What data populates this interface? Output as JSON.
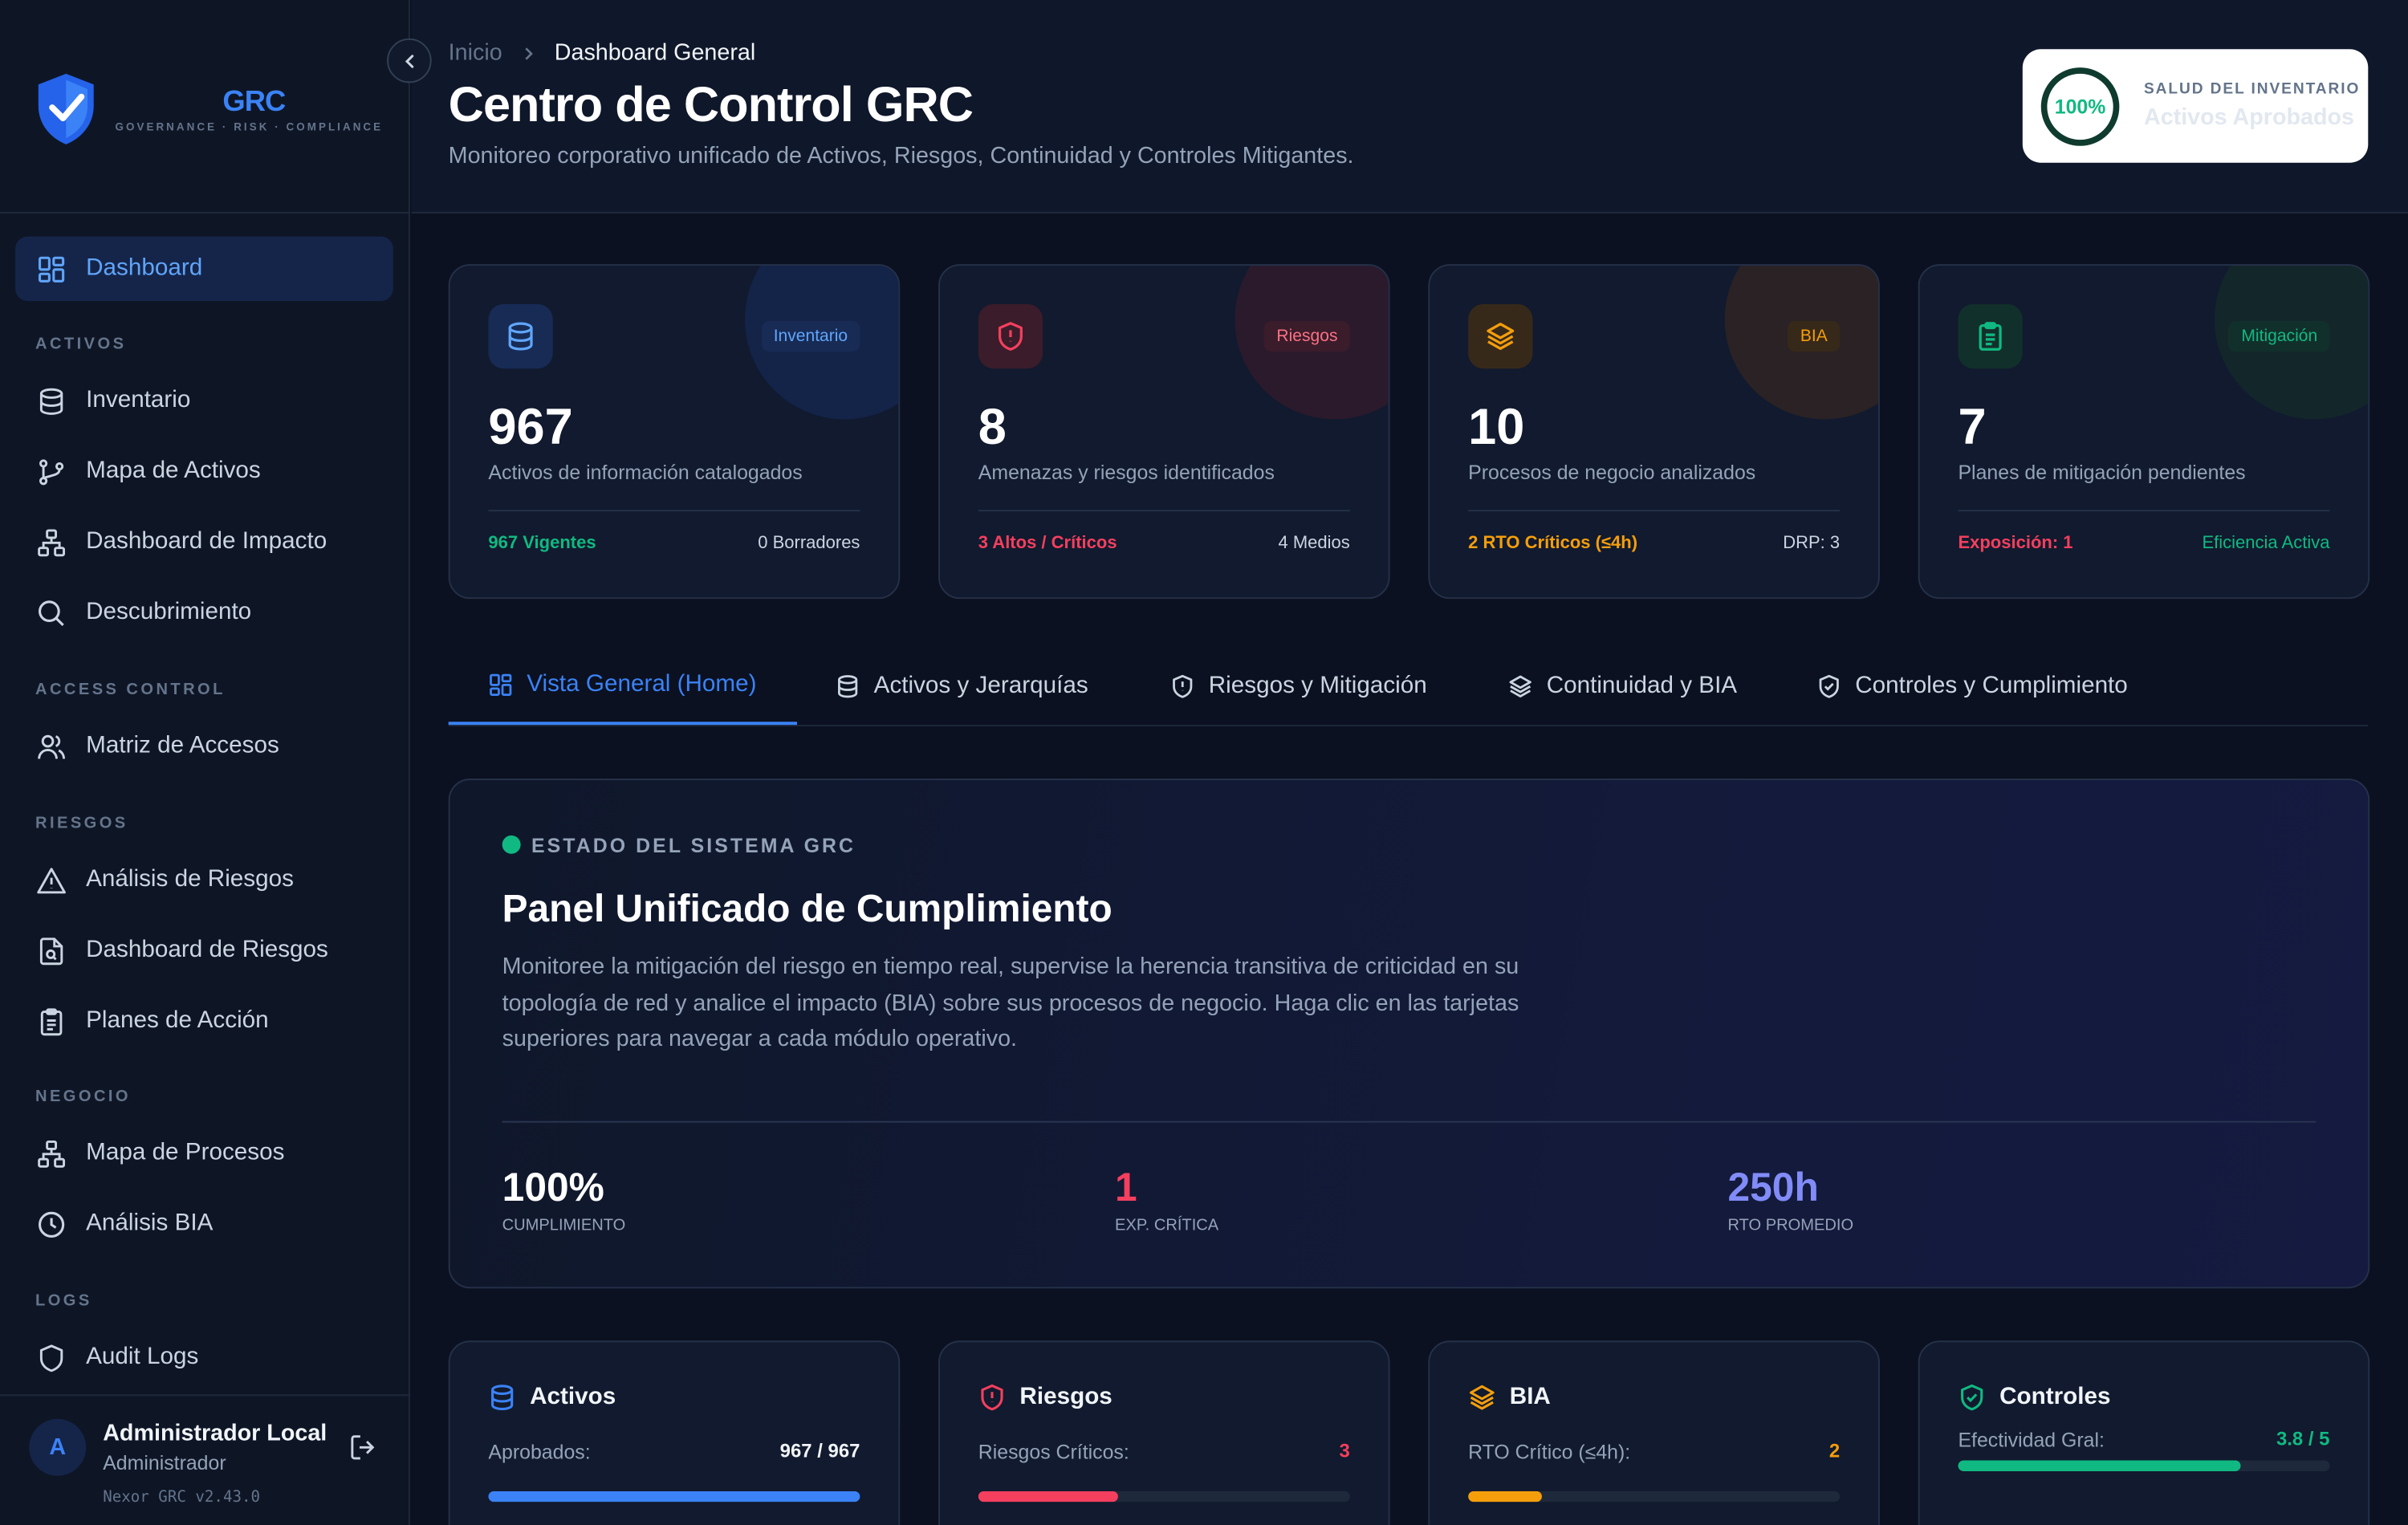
{
  "brand": {
    "logo_text": "GRC",
    "tagline": "GOVERNANCE · RISK · COMPLIANCE"
  },
  "sidebar": {
    "sections": {
      "activos": "ACTIVOS",
      "access": "ACCESS CONTROL",
      "riesgos": "RIESGOS",
      "negocio": "NEGOCIO",
      "logs": "LOGS"
    },
    "items": [
      {
        "label": "Dashboard",
        "icon": "grid-icon",
        "active": true
      },
      {
        "label": "Inventario",
        "icon": "database-icon"
      },
      {
        "label": "Mapa de Activos",
        "icon": "branch-icon"
      },
      {
        "label": "Dashboard de Impacto",
        "icon": "network-icon"
      },
      {
        "label": "Descubrimiento",
        "icon": "search-icon"
      },
      {
        "label": "Matriz de Accesos",
        "icon": "users-icon"
      },
      {
        "label": "Análisis de Riesgos",
        "icon": "warning-icon"
      },
      {
        "label": "Dashboard de Riesgos",
        "icon": "file-search-icon"
      },
      {
        "label": "Planes de Acción",
        "icon": "clipboard-icon"
      },
      {
        "label": "Mapa de Procesos",
        "icon": "network-icon"
      },
      {
        "label": "Análisis BIA",
        "icon": "clock-icon"
      },
      {
        "label": "Audit Logs",
        "icon": "shield-icon"
      }
    ],
    "user": {
      "initial": "A",
      "name": "Administrador Local",
      "role": "Administrador",
      "version": "Nexor GRC v2.43.0"
    }
  },
  "header": {
    "breadcrumb": {
      "root": "Inicio",
      "current": "Dashboard General"
    },
    "title": "Centro de Control GRC",
    "subtitle": "Monitoreo corporativo unificado de Activos, Riesgos, Continuidad y Controles Mitigantes.",
    "health": {
      "value": "100%",
      "label": "SALUD DEL INVENTARIO",
      "status": "Activos Aprobados"
    }
  },
  "kpis": [
    {
      "badge": "Inventario",
      "value": "967",
      "desc": "Activos de información catalogados",
      "left": "967 Vigentes",
      "right": "0 Borradores",
      "color": "#3b82f6",
      "icon": "database-icon"
    },
    {
      "badge": "Riesgos",
      "value": "8",
      "desc": "Amenazas y riesgos identificados",
      "left": "3 Altos / Críticos",
      "right": "4 Medios",
      "color": "#f43f5e",
      "icon": "shield-alert-icon"
    },
    {
      "badge": "BIA",
      "value": "10",
      "desc": "Procesos de negocio analizados",
      "left": "2 RTO Críticos (≤4h)",
      "right": "DRP: 3",
      "color": "#f59e0b",
      "icon": "layers-icon"
    },
    {
      "badge": "Mitigación",
      "value": "7",
      "desc": "Planes de mitigación pendientes",
      "left": "Exposición: 1",
      "right": "Eficiencia Activa",
      "color": "#10b981",
      "icon": "clipboard-icon"
    }
  ],
  "tabs": [
    {
      "label": "Vista General (Home)",
      "icon": "grid-icon",
      "active": true
    },
    {
      "label": "Activos y Jerarquías",
      "icon": "database-icon"
    },
    {
      "label": "Riesgos y Mitigación",
      "icon": "shield-alert-icon"
    },
    {
      "label": "Continuidad y BIA",
      "icon": "layers-icon"
    },
    {
      "label": "Controles y Cumplimiento",
      "icon": "shield-check-icon"
    }
  ],
  "hero": {
    "eyebrow": "ESTADO DEL SISTEMA GRC",
    "title": "Panel Unificado de Cumplimiento",
    "description": "Monitoree la mitigación del riesgo en tiempo real, supervise la herencia transitiva de criticidad en su topología de red y analice el impacto (BIA) sobre sus procesos de negocio. Haga clic en las tarjetas superiores para navegar a cada módulo operativo.",
    "stats": [
      {
        "value": "100%",
        "label": "CUMPLIMIENTO",
        "color": "#ffffff"
      },
      {
        "value": "1",
        "label": "EXP. CRÍTICA",
        "color": "#f43f5e"
      },
      {
        "value": "250h",
        "label": "RTO PROMEDIO",
        "color": "#818cf8"
      }
    ]
  },
  "summary_cards": [
    {
      "title": "Activos",
      "label": "Aprobados:",
      "value": "967 / 967",
      "progress": 1.0,
      "color": "#3b82f6",
      "value_color": "#f1f5f9",
      "icon": "database-icon"
    },
    {
      "title": "Riesgos",
      "label": "Riesgos Críticos:",
      "value": "3",
      "progress": 0.375,
      "color": "#f43f5e",
      "value_color": "#f43f5e",
      "icon": "shield-alert-icon"
    },
    {
      "title": "BIA",
      "label": "RTO Crítico (≤4h):",
      "value": "2",
      "progress": 0.2,
      "color": "#f59e0b",
      "value_color": "#f59e0b",
      "icon": "layers-icon"
    },
    {
      "title": "Controles",
      "label": "Efectividad Gral:",
      "value": "3.8 / 5",
      "progress": 0.76,
      "color": "#10b981",
      "value_color": "#10b981",
      "icon": "shield-check-icon"
    }
  ]
}
